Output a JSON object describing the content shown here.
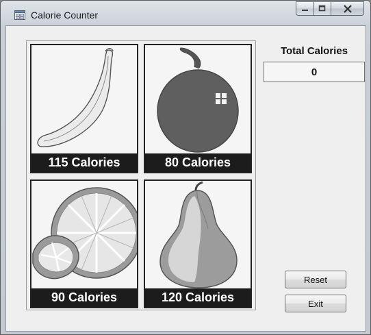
{
  "window": {
    "title": "Calorie Counter",
    "icon": "form-icon",
    "caption_buttons": [
      "minimize-icon",
      "maximize-icon",
      "close-icon"
    ]
  },
  "fruits": [
    {
      "name": "banana",
      "calories_label": "115 Calories",
      "image": "banana-icon"
    },
    {
      "name": "apple",
      "calories_label": "80 Calories",
      "image": "apple-icon"
    },
    {
      "name": "orange",
      "calories_label": "90 Calories",
      "image": "orange-icon"
    },
    {
      "name": "pear",
      "calories_label": "120 Calories",
      "image": "pear-icon"
    }
  ],
  "total": {
    "label": "Total Calories",
    "value": "0"
  },
  "buttons": {
    "reset_label": "Reset",
    "exit_label": "Exit"
  }
}
